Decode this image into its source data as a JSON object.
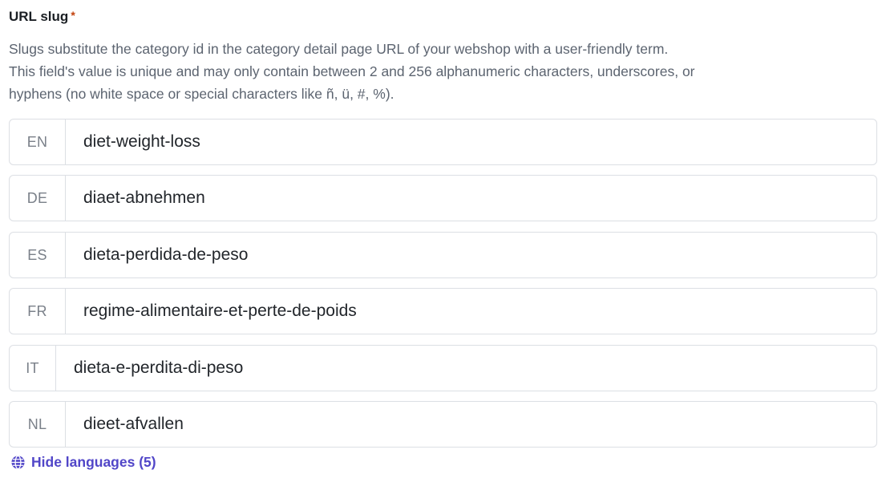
{
  "field": {
    "label": "URL slug",
    "required_marker": "*",
    "help_lines": [
      "Slugs substitute the category id in the category detail page URL of your webshop with a user-friendly term.",
      "This field's value is unique and may only contain between 2 and 256 alphanumeric characters, underscores, or",
      "hyphens (no white space or special characters like ñ, ü, #, %)."
    ]
  },
  "languages": [
    {
      "code": "EN",
      "value": "diet-weight-loss"
    },
    {
      "code": "DE",
      "value": "diaet-abnehmen"
    },
    {
      "code": "ES",
      "value": "dieta-perdida-de-peso"
    },
    {
      "code": "FR",
      "value": "regime-alimentaire-et-perte-de-poids"
    },
    {
      "code": "IT",
      "value": "dieta-e-perdita-di-peso"
    },
    {
      "code": "NL",
      "value": "dieet-afvallen"
    }
  ],
  "toggle": {
    "label": "Hide languages (5)",
    "icon": "globe-icon",
    "color": "#5146c8"
  }
}
